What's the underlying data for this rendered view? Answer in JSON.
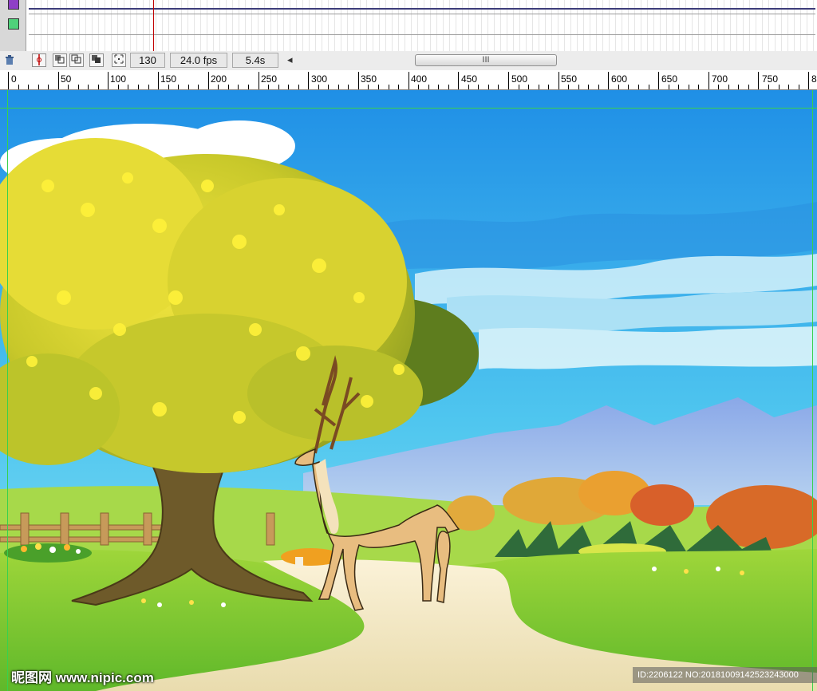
{
  "statusbar": {
    "current_frame": "130",
    "frame_rate": "24.0 fps",
    "elapsed_time": "5.4s",
    "scroll_left_arrow": "◂",
    "scroll_thumb_grip": "III"
  },
  "ruler": {
    "labels": [
      "0",
      "50",
      "100",
      "150",
      "200",
      "250",
      "300",
      "350",
      "400",
      "450",
      "500",
      "550",
      "600",
      "650",
      "700",
      "750",
      "8"
    ]
  },
  "watermark": {
    "left_text": "昵图网 www.nipic.com",
    "right_text": "ID:2206122 NO:20181009142523243000"
  },
  "colors": {
    "layer1": "#8e3fc6",
    "layer2": "#4fd17a",
    "guide": "#39d14d",
    "playhead": "#c00000"
  }
}
